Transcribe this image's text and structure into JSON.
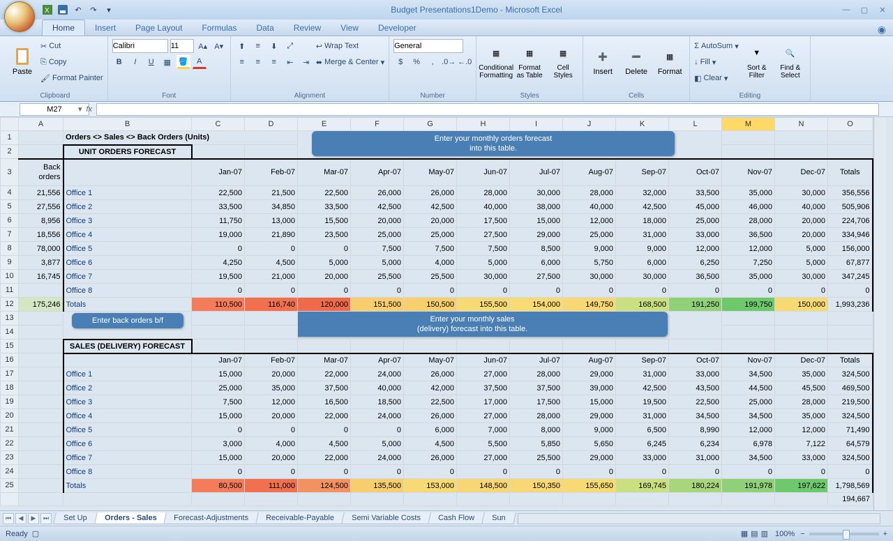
{
  "title": "Budget Presentations1Demo - Microsoft Excel",
  "ribbon_tabs": [
    "Home",
    "Insert",
    "Page Layout",
    "Formulas",
    "Data",
    "Review",
    "View",
    "Developer"
  ],
  "active_tab": "Home",
  "clipboard": {
    "label": "Clipboard",
    "paste": "Paste",
    "cut": "Cut",
    "copy": "Copy",
    "fp": "Format Painter"
  },
  "font": {
    "label": "Font",
    "name": "Calibri",
    "size": "11"
  },
  "alignment": {
    "label": "Alignment",
    "wrap": "Wrap Text",
    "merge": "Merge & Center"
  },
  "number": {
    "label": "Number",
    "format": "General"
  },
  "styles": {
    "label": "Styles",
    "cf": "Conditional\nFormatting",
    "fat": "Format\nas Table",
    "cs": "Cell\nStyles"
  },
  "cells": {
    "label": "Cells",
    "insert": "Insert",
    "delete": "Delete",
    "format": "Format"
  },
  "editing": {
    "label": "Editing",
    "autosum": "AutoSum",
    "fill": "Fill",
    "clear": "Clear",
    "sort": "Sort &\nFilter",
    "find": "Find &\nSelect"
  },
  "namebox": "M27",
  "formula": "",
  "columns": [
    "A",
    "B",
    "C",
    "D",
    "E",
    "F",
    "G",
    "H",
    "I",
    "J",
    "K",
    "L",
    "M",
    "N",
    "O"
  ],
  "rows": [
    "1",
    "2",
    "3",
    "4",
    "5",
    "6",
    "7",
    "8",
    "9",
    "10",
    "11",
    "12",
    "13",
    "14",
    "15",
    "16",
    "17",
    "18",
    "19",
    "20",
    "21",
    "22",
    "23",
    "24",
    "25",
    ""
  ],
  "a1": "Orders <> Sales <> Back Orders (Units)",
  "unit_hdr": "UNIT ORDERS FORECAST",
  "sales_hdr": "SALES (DELIVERY) FORECAST",
  "back_orders_lbl1": "Back",
  "back_orders_lbl2": "orders",
  "months": [
    "Jan-07",
    "Feb-07",
    "Mar-07",
    "Apr-07",
    "May-07",
    "Jun-07",
    "Jul-07",
    "Aug-07",
    "Sep-07",
    "Oct-07",
    "Nov-07",
    "Dec-07"
  ],
  "totals_lbl": "Totals",
  "callout1": "Enter your monthly  orders forecast\ninto this table.",
  "callout2": "Enter back orders b/f",
  "callout3": "Enter your monthly sales\n(delivery) forecast into this table.",
  "orders": {
    "back": [
      "21,556",
      "27,556",
      "8,956",
      "18,556",
      "78,000",
      "3,877",
      "16,745",
      ""
    ],
    "offices": [
      "Office 1",
      "Office 2",
      "Office 3",
      "Office 4",
      "Office 5",
      "Office 6",
      "Office 7",
      "Office 8"
    ],
    "data": [
      [
        "22,500",
        "21,500",
        "22,500",
        "26,000",
        "26,000",
        "28,000",
        "30,000",
        "28,000",
        "32,000",
        "33,500",
        "35,000",
        "30,000",
        "356,556"
      ],
      [
        "33,500",
        "34,850",
        "33,500",
        "42,500",
        "42,500",
        "40,000",
        "38,000",
        "40,000",
        "42,500",
        "45,000",
        "46,000",
        "40,000",
        "505,906"
      ],
      [
        "11,750",
        "13,000",
        "15,500",
        "20,000",
        "20,000",
        "17,500",
        "15,000",
        "12,000",
        "18,000",
        "25,000",
        "28,000",
        "20,000",
        "224,706"
      ],
      [
        "19,000",
        "21,890",
        "23,500",
        "25,000",
        "25,000",
        "27,500",
        "29,000",
        "25,000",
        "31,000",
        "33,000",
        "36,500",
        "20,000",
        "334,946"
      ],
      [
        "0",
        "0",
        "0",
        "7,500",
        "7,500",
        "7,500",
        "8,500",
        "9,000",
        "9,000",
        "12,000",
        "12,000",
        "5,000",
        "156,000"
      ],
      [
        "4,250",
        "4,500",
        "5,000",
        "5,000",
        "4,000",
        "5,000",
        "6,000",
        "5,750",
        "6,000",
        "6,250",
        "7,250",
        "5,000",
        "67,877"
      ],
      [
        "19,500",
        "21,000",
        "20,000",
        "25,500",
        "25,500",
        "30,000",
        "27,500",
        "30,000",
        "30,000",
        "36,500",
        "35,000",
        "30,000",
        "347,245"
      ],
      [
        "0",
        "0",
        "0",
        "0",
        "0",
        "0",
        "0",
        "0",
        "0",
        "0",
        "0",
        "0",
        "0"
      ]
    ],
    "totals": [
      "110,500",
      "116,740",
      "120,000",
      "151,500",
      "150,500",
      "155,500",
      "154,000",
      "149,750",
      "168,500",
      "191,250",
      "199,750",
      "150,000",
      "1,993,236"
    ],
    "back_total": "175,246"
  },
  "sales": {
    "offices": [
      "Office 1",
      "Office 2",
      "Office 3",
      "Office 4",
      "Office 5",
      "Office 6",
      "Office 7",
      "Office 8"
    ],
    "data": [
      [
        "15,000",
        "20,000",
        "22,000",
        "24,000",
        "26,000",
        "27,000",
        "28,000",
        "29,000",
        "31,000",
        "33,000",
        "34,500",
        "35,000",
        "324,500"
      ],
      [
        "25,000",
        "35,000",
        "37,500",
        "40,000",
        "42,000",
        "37,500",
        "37,500",
        "39,000",
        "42,500",
        "43,500",
        "44,500",
        "45,500",
        "469,500"
      ],
      [
        "7,500",
        "12,000",
        "16,500",
        "18,500",
        "22,500",
        "17,000",
        "17,500",
        "15,000",
        "19,500",
        "22,500",
        "25,000",
        "28,000",
        "219,500"
      ],
      [
        "15,000",
        "20,000",
        "22,000",
        "24,000",
        "26,000",
        "27,000",
        "28,000",
        "29,000",
        "31,000",
        "34,500",
        "34,500",
        "35,000",
        "324,500"
      ],
      [
        "0",
        "0",
        "0",
        "0",
        "6,000",
        "7,000",
        "8,000",
        "9,000",
        "6,500",
        "8,990",
        "12,000",
        "12,000",
        "71,490"
      ],
      [
        "3,000",
        "4,000",
        "4,500",
        "5,000",
        "4,500",
        "5,500",
        "5,850",
        "5,650",
        "6,245",
        "6,234",
        "6,978",
        "7,122",
        "64,579"
      ],
      [
        "15,000",
        "20,000",
        "22,000",
        "24,000",
        "26,000",
        "27,000",
        "25,500",
        "29,000",
        "33,000",
        "31,000",
        "34,500",
        "33,000",
        "324,500"
      ],
      [
        "0",
        "0",
        "0",
        "0",
        "0",
        "0",
        "0",
        "0",
        "0",
        "0",
        "0",
        "0",
        "0"
      ]
    ],
    "totals": [
      "80,500",
      "111,000",
      "124,500",
      "135,500",
      "153,000",
      "148,500",
      "150,350",
      "155,650",
      "169,745",
      "180,224",
      "191,978",
      "197,622",
      "1,798,569"
    ],
    "extra": "194,667"
  },
  "heat1": [
    "#f47c5a",
    "#f07050",
    "#ef6a4a",
    "#f7cd6e",
    "#f7d06e",
    "#f8da74",
    "#f8db74",
    "#f8d874",
    "#c9df80",
    "#8fd078",
    "#6ec86c",
    "#f8da74"
  ],
  "heat2": [
    "#f47c5a",
    "#f07050",
    "#f29260",
    "#f7cd6e",
    "#f8da74",
    "#f8d674",
    "#f8d774",
    "#f8da74",
    "#c9df80",
    "#a8d67c",
    "#8fd078",
    "#6ec86c"
  ],
  "sheet_tabs": [
    "Set Up",
    "Orders - Sales",
    "Forecast-Adjustments",
    "Receivable-Payable",
    "Semi Variable Costs",
    "Cash Flow",
    "Sun"
  ],
  "active_sheet": "Orders - Sales",
  "status": "Ready",
  "zoom": "100%"
}
